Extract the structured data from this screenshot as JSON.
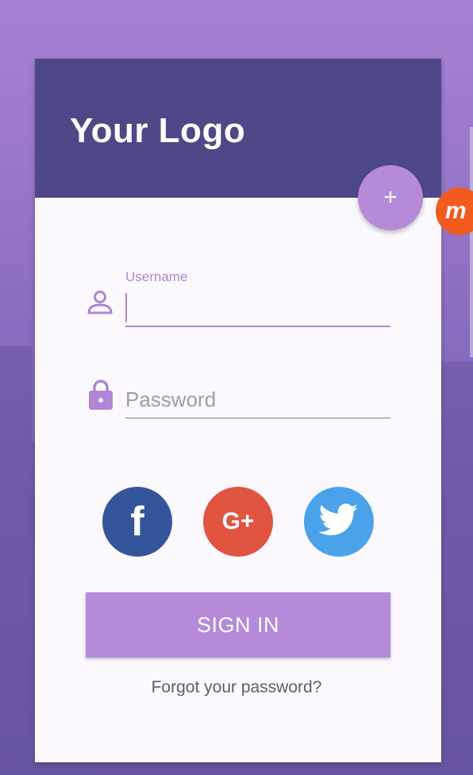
{
  "header": {
    "logo_text": "Your Logo",
    "fab_label": "+"
  },
  "badge": {
    "label": "m"
  },
  "form": {
    "username": {
      "label": "Username",
      "value": ""
    },
    "password": {
      "placeholder": "Password",
      "value": ""
    }
  },
  "social": [
    {
      "name": "facebook",
      "glyph": "f",
      "color": "#35559b"
    },
    {
      "name": "google-plus",
      "glyph": "G+",
      "color": "#e05440"
    },
    {
      "name": "twitter",
      "glyph": "",
      "color": "#4aa2ea"
    }
  ],
  "actions": {
    "sign_in_label": "SIGN IN",
    "forgot_label": "Forgot your password?"
  },
  "colors": {
    "accent": "#b48ad9",
    "header": "#4e4888",
    "card": "#fbf9fd"
  }
}
